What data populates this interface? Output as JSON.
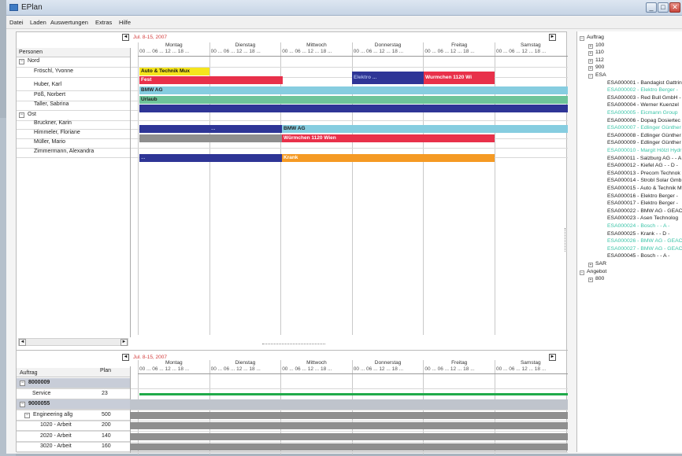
{
  "window": {
    "title": "EPlan",
    "controls": [
      "minimize-icon",
      "maximize-icon",
      "close-icon"
    ]
  },
  "menu": [
    "Datei",
    "Laden",
    "Auswertungen",
    "Extras",
    "Hilfe"
  ],
  "colors": {
    "yellow": "#f5e51d",
    "red": "#e8304a",
    "dark_blue": "#2e3596",
    "light_blue": "#86cde0",
    "green": "#6ec49a",
    "gray": "#8e8e8e",
    "orange": "#f59a24",
    "plan_green": "#1faa4a",
    "plan_gray": "#8f8f8f",
    "tree_highlight": "#3cc4a8"
  },
  "top_gantt": {
    "nav_prev": "◄",
    "nav_next": "►",
    "date_range": "Jul. 8-15, 2007",
    "days": [
      "Montag",
      "Dienstag",
      "Mittwoch",
      "Donnerstag",
      "Freitag",
      "Samstag"
    ],
    "tick_text": "00 ... 06 ... 12 ... 18 ...",
    "column_header": "Personen",
    "rows": [
      {
        "type": "group",
        "label": "Nord",
        "toggle": "−"
      },
      {
        "type": "person",
        "label": "Fröschl, Yvonne"
      },
      {
        "type": "person",
        "label": "Huber, Karl"
      },
      {
        "type": "person",
        "label": "Pöß, Norbert"
      },
      {
        "type": "person",
        "label": "Taller, Sabrina"
      },
      {
        "type": "group",
        "label": "Ost",
        "toggle": "−"
      },
      {
        "type": "person",
        "label": "Bruckner, Karin"
      },
      {
        "type": "person",
        "label": "Himmeler, Floriane"
      },
      {
        "type": "person",
        "label": "Müller, Mario"
      },
      {
        "type": "person",
        "label": "Zimmermann, Alexandra"
      }
    ],
    "bars": [
      {
        "label": "Auto & Technik Mux"
      },
      {
        "label": "Fest"
      },
      {
        "label": "Elektro ..."
      },
      {
        "label": "Wurmchen 1120 Wi"
      },
      {
        "label": "BMW AG"
      },
      {
        "label": "Urlaub"
      },
      {
        "label": ""
      },
      {
        "label": "..."
      },
      {
        "label": "BMW AG"
      },
      {
        "label": "Würmchen 1120 Wien"
      },
      {
        "label": "..."
      },
      {
        "label": "Krank"
      }
    ],
    "scroll_left": "◄",
    "scroll_right": "►"
  },
  "bottom_gantt": {
    "nav_prev": "◄",
    "nav_next": "►",
    "date_range": "Jul. 8-15, 2007",
    "days": [
      "Montag",
      "Dienstag",
      "Mittwoch",
      "Donnerstag",
      "Freitag",
      "Samstag"
    ],
    "tick_text": "00 ... 06 ... 12 ... 18 ...",
    "col_auftrag": "Auftrag",
    "col_plan": "Plan",
    "rows": [
      {
        "label": "8000009",
        "plan": "",
        "kind": "order",
        "toggle": "−"
      },
      {
        "label": "Service",
        "plan": "23",
        "kind": "item"
      },
      {
        "label": "9000055",
        "plan": "",
        "kind": "order",
        "toggle": "−"
      },
      {
        "label": "Engineering allg",
        "plan": "500",
        "kind": "sub",
        "toggle": "−"
      },
      {
        "label": "1020 - Arbeit",
        "plan": "200",
        "kind": "item"
      },
      {
        "label": "2020 - Arbeit",
        "plan": "140",
        "kind": "item"
      },
      {
        "label": "3020 - Arbeit",
        "plan": "160",
        "kind": "item"
      }
    ]
  },
  "tree": {
    "root": "Auftrag",
    "top_nodes": [
      "100",
      "110",
      "112",
      "900"
    ],
    "esa": "ESA",
    "esa_items": [
      {
        "text": "ESA000001 - Bandagist Gattrin",
        "hl": false
      },
      {
        "text": "ESA000002 - Elektro Berger -",
        "hl": true
      },
      {
        "text": "ESA000003 - Red Bull GmbH -",
        "hl": false
      },
      {
        "text": "ESA000004 - Werner Kuenzel",
        "hl": false
      },
      {
        "text": "ESA000005 - Eicmann Group",
        "hl": true
      },
      {
        "text": "ESA000006 - Dopag Dosiertec",
        "hl": false
      },
      {
        "text": "ESA000007 - Edlinger Günther",
        "hl": true
      },
      {
        "text": "ESA000008 - Edlinger Günther",
        "hl": false
      },
      {
        "text": "ESA000009 - Edlinger Günther",
        "hl": false
      },
      {
        "text": "ESA000010 - Margit Hölzl Hydr",
        "hl": true
      },
      {
        "text": "ESA000011 - Salzburg AG - - A",
        "hl": false
      },
      {
        "text": "ESA000012 - Kiefel AG - - D -",
        "hl": false
      },
      {
        "text": "ESA000013 - Precom Technok",
        "hl": false
      },
      {
        "text": "ESA000014 - Strobl Solar GmbH",
        "hl": false
      },
      {
        "text": "ESA000015 - Auto & Technik M",
        "hl": false
      },
      {
        "text": "ESA000016 - Elektro Berger -",
        "hl": false
      },
      {
        "text": "ESA000017 - Elektro Berger -",
        "hl": false
      },
      {
        "text": "ESA000022 - BMW AG - GEAC",
        "hl": false
      },
      {
        "text": "ESA000023 - Asen Technolog",
        "hl": false
      },
      {
        "text": "ESA000024 - Bosch - - A -",
        "hl": true
      },
      {
        "text": "ESA000025 - Krank - - D -",
        "hl": false
      },
      {
        "text": "ESA000026 - BMW AG - GEAC",
        "hl": true
      },
      {
        "text": "ESA000027 - BMW AG - GEAC",
        "hl": true
      },
      {
        "text": "ESA000045 - Bosch - - A -",
        "hl": false
      }
    ],
    "sar": "SAR",
    "angebot": "Angebot",
    "angebot_children": [
      "800"
    ],
    "plus": "+",
    "minus": "−"
  }
}
